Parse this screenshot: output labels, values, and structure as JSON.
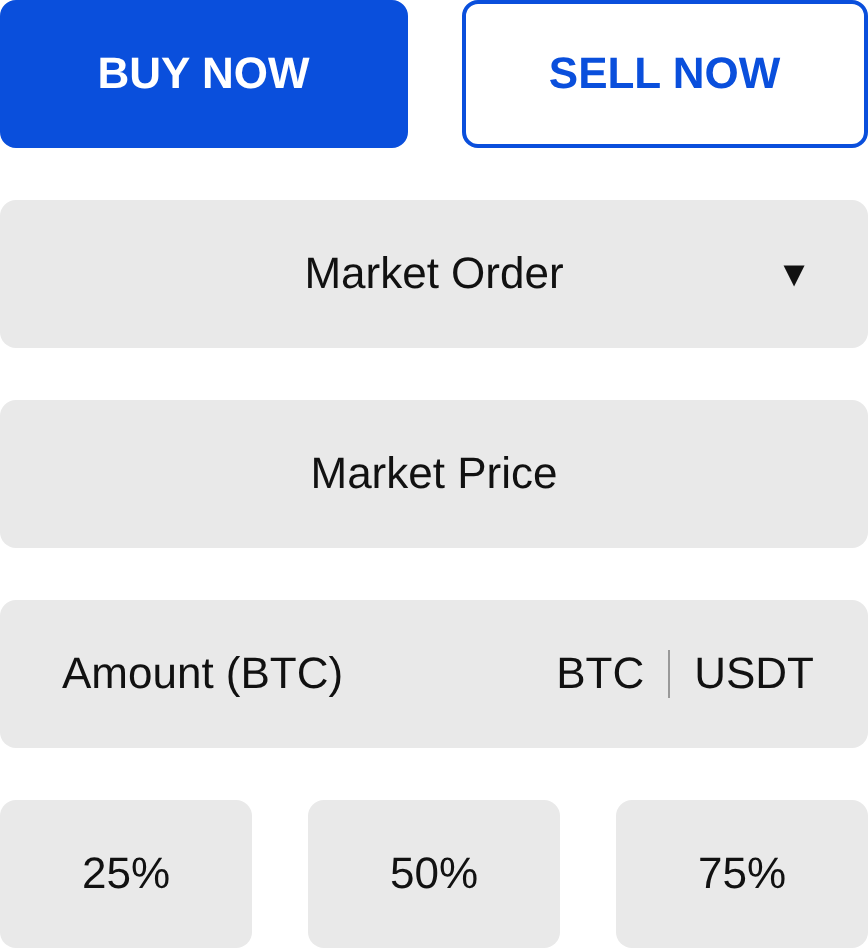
{
  "actions": [
    {
      "label": "BUY NOW",
      "kind": "filled"
    },
    {
      "label": "SELL NOW",
      "kind": "outline"
    }
  ],
  "order_type": {
    "value": "Market Order",
    "caret": "▼"
  },
  "price": {
    "value": "Market Price"
  },
  "amount": {
    "placeholder": "Amount (BTC)",
    "units": [
      "BTC",
      "USDT"
    ]
  },
  "percentages": [
    "25%",
    "50%",
    "75%"
  ]
}
